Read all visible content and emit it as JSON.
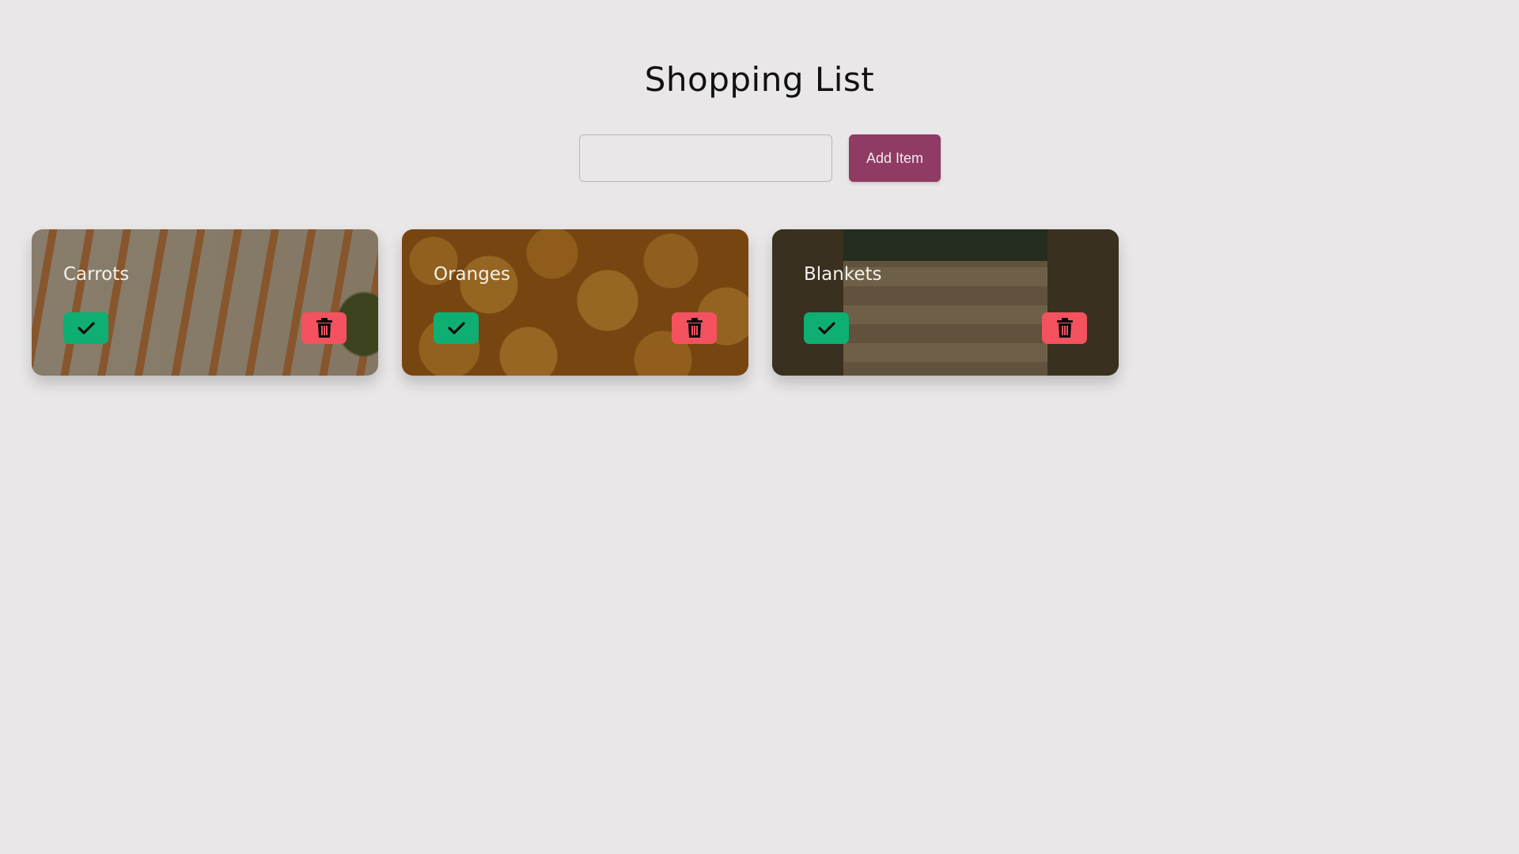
{
  "page": {
    "title": "Shopping List"
  },
  "add_form": {
    "input_value": "",
    "button_label": "Add Item"
  },
  "items": [
    {
      "name": "Carrots",
      "complete_icon": "check-icon",
      "delete_icon": "trash-icon"
    },
    {
      "name": "Oranges",
      "complete_icon": "check-icon",
      "delete_icon": "trash-icon"
    },
    {
      "name": "Blankets",
      "complete_icon": "check-icon",
      "delete_icon": "trash-icon"
    }
  ],
  "colors": {
    "background": "#e9e7e8",
    "add_button": "#8f3b63",
    "complete_button": "#0fae72",
    "delete_button": "#f4525e"
  }
}
